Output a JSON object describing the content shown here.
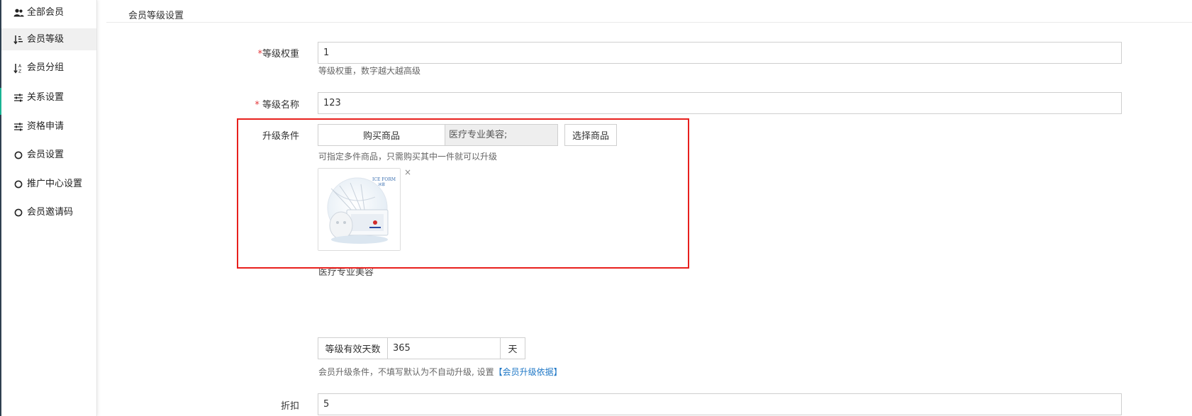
{
  "sidebar": {
    "items": [
      {
        "label": "全部会员",
        "icon": "users-icon"
      },
      {
        "label": "会员等级",
        "icon": "sort-amount-icon"
      },
      {
        "label": "会员分组",
        "icon": "sort-alpha-icon"
      },
      {
        "label": "关系设置",
        "icon": "sliders-icon"
      },
      {
        "label": "资格申请",
        "icon": "sliders-icon"
      },
      {
        "label": "会员设置",
        "icon": "circle-icon"
      },
      {
        "label": "推广中心设置",
        "icon": "circle-icon"
      },
      {
        "label": "会员邀请码",
        "icon": "circle-icon"
      }
    ]
  },
  "header": {
    "title": "会员等级设置"
  },
  "form": {
    "weight": {
      "required_mark": "*",
      "label": "等级权重",
      "value": "1",
      "help": "等级权重，数字越大越高级"
    },
    "name": {
      "required_mark": "*",
      "label": "等级名称",
      "value": "123"
    },
    "upgrade": {
      "label": "升级条件",
      "buy_addon": "购买商品",
      "selected_goods": "医疗专业美容;",
      "select_button": "选择商品",
      "help": "可指定多件商品，只需购买其中一件就可以升级",
      "remove": "×",
      "goods_title": "医疗专业美容",
      "thumb_brand": "ICE FORM",
      "thumb_brand_sub": "冰霏"
    },
    "validity": {
      "addon": "等级有效天数",
      "value": "365",
      "unit": "天",
      "help_prefix": "会员升级条件，不填写默认为不自动升级, 设置",
      "help_link": "【会员升级依据】"
    },
    "discount": {
      "label": "折扣",
      "value": "5"
    }
  },
  "colors": {
    "highlight": "#e8201d",
    "link": "#1e77c6",
    "sidebar_accent": "#1ab394",
    "required": "#e4393c"
  }
}
